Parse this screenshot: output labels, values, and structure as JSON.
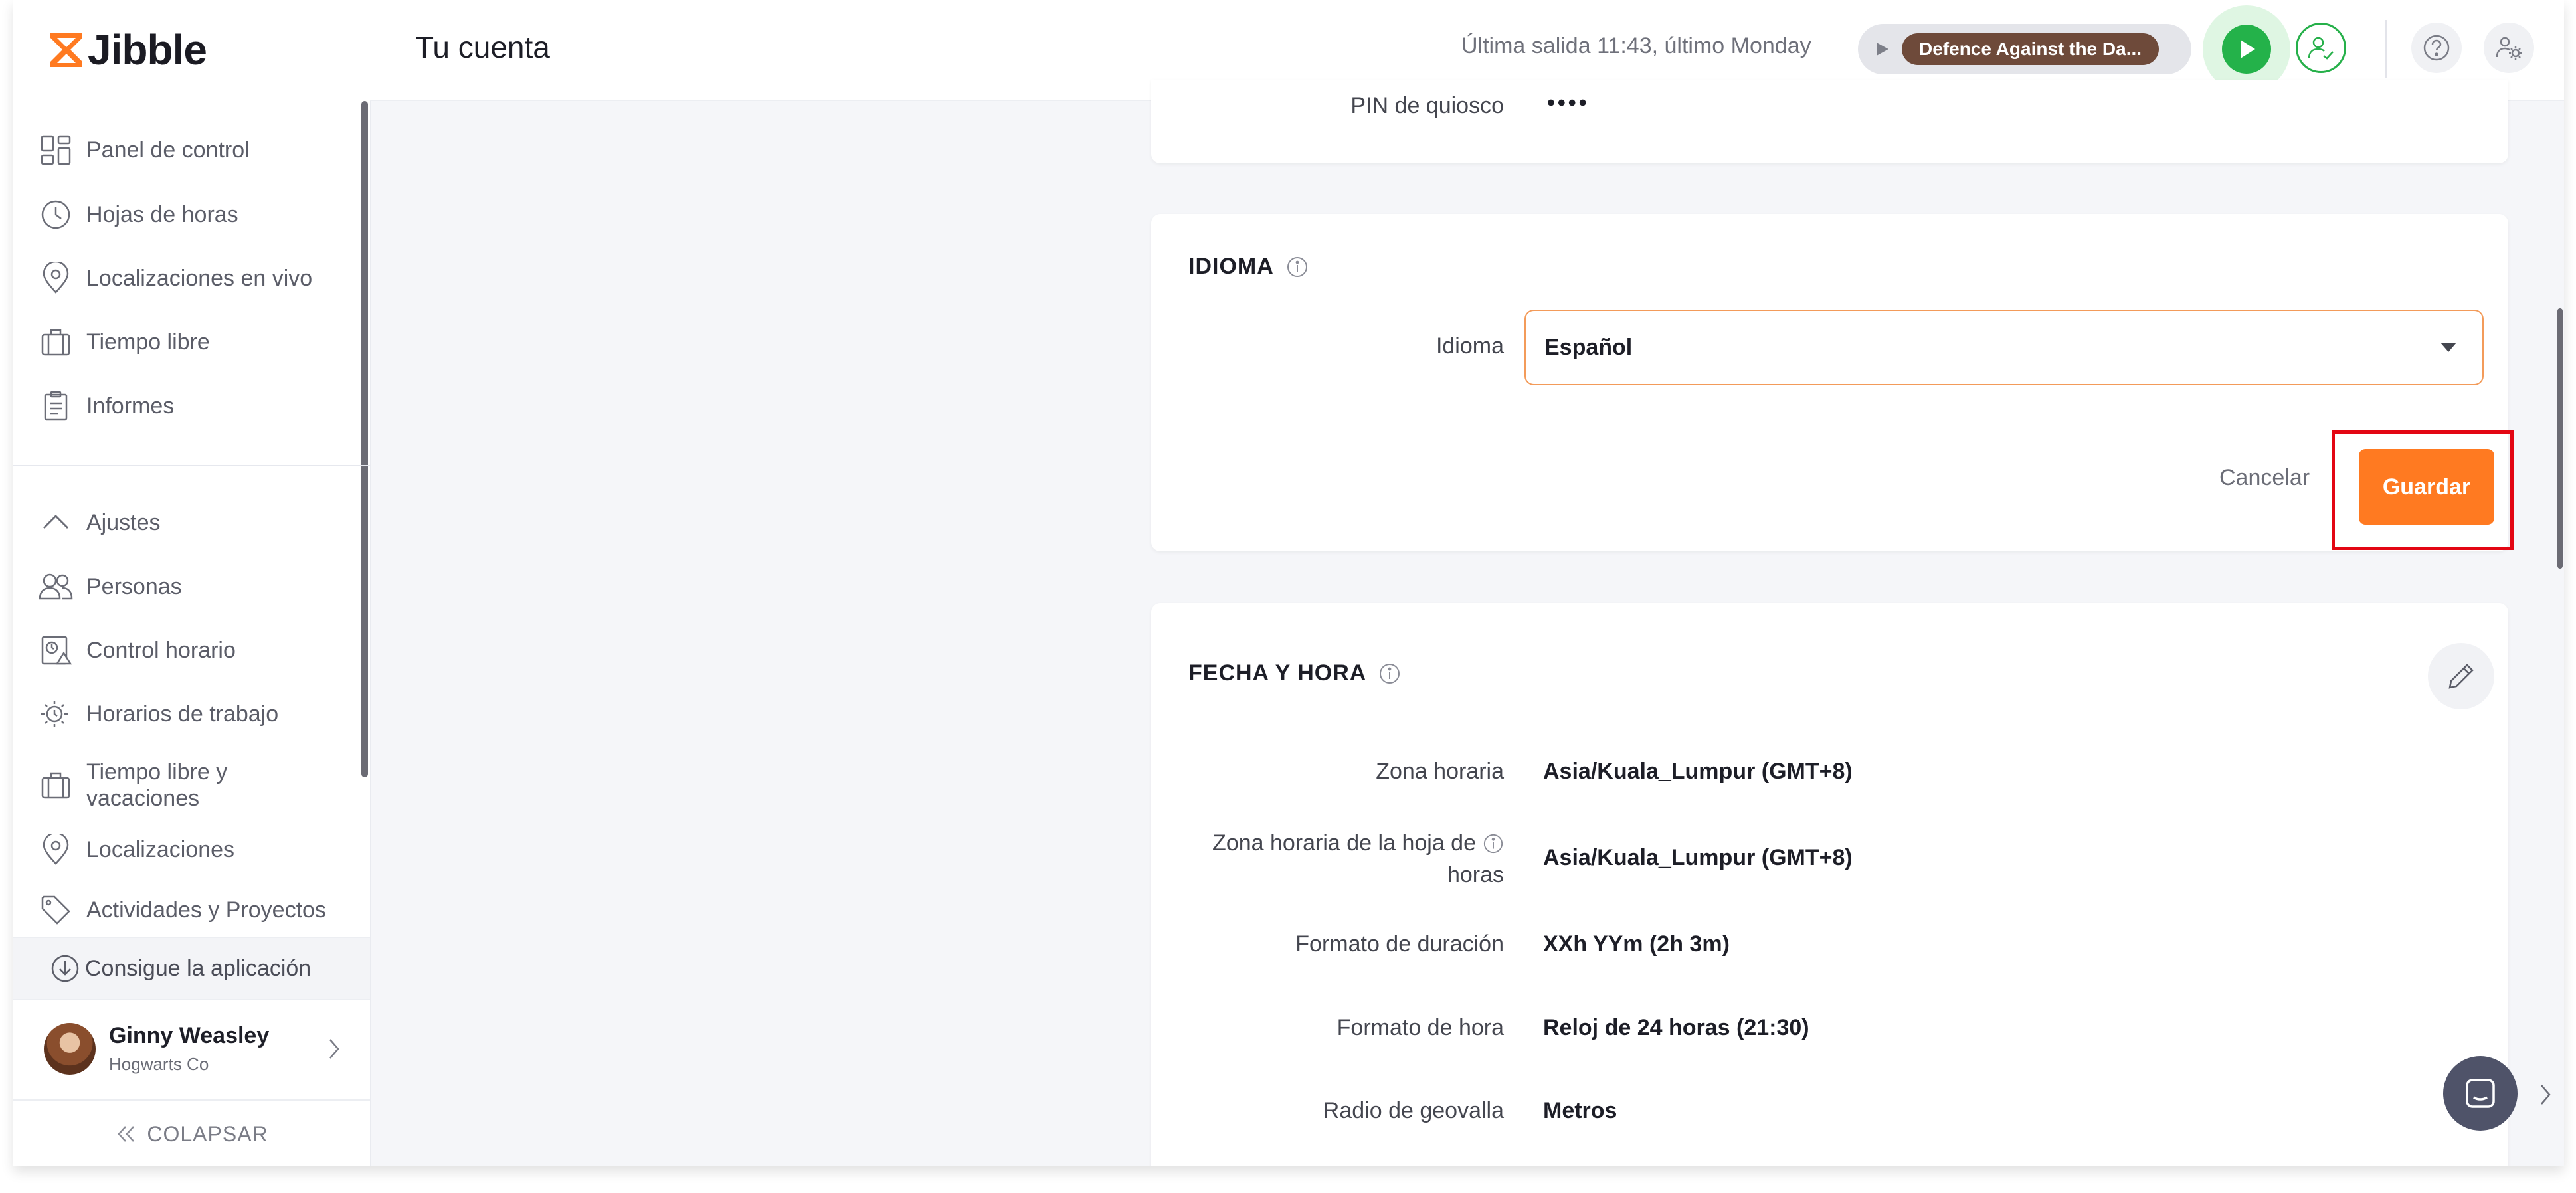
{
  "app": {
    "name": "Jibble"
  },
  "sidebar": {
    "items": [
      {
        "label": "Panel de control",
        "icon": "dashboard-icon"
      },
      {
        "label": "Hojas de horas",
        "icon": "clock-icon"
      },
      {
        "label": "Localizaciones en vivo",
        "icon": "location-pin-icon"
      },
      {
        "label": "Tiempo libre",
        "icon": "suitcase-icon"
      },
      {
        "label": "Informes",
        "icon": "report-icon"
      }
    ],
    "settings": {
      "label": "Ajustes",
      "items": [
        {
          "label": "Personas",
          "icon": "people-icon"
        },
        {
          "label": "Control horario",
          "icon": "time-tracking-icon"
        },
        {
          "label": "Horarios de trabajo",
          "icon": "work-schedule-icon"
        },
        {
          "label": "Tiempo libre y vacaciones",
          "icon": "suitcase-icon"
        },
        {
          "label": "Localizaciones",
          "icon": "location-pin-icon"
        },
        {
          "label": "Actividades y Proyectos",
          "icon": "tag-icon"
        }
      ]
    },
    "get_app": "Consigue la aplicación",
    "user": {
      "name": "Ginny Weasley",
      "org": "Hogwarts Co"
    },
    "collapse": "COLAPSAR"
  },
  "header": {
    "title": "Tu cuenta",
    "last_out": "Última salida 11:43, último Monday",
    "activity": "Defence Against the Da..."
  },
  "account": {
    "kiosk_pin": {
      "label": "PIN de quiosco",
      "value": "••••"
    },
    "language": {
      "title": "IDIOMA",
      "label": "Idioma",
      "value": "Español",
      "cancel": "Cancelar",
      "save": "Guardar"
    },
    "datetime": {
      "title": "FECHA Y HORA",
      "fields": [
        {
          "label": "Zona horaria",
          "value": "Asia/Kuala_Lumpur (GMT+8)"
        },
        {
          "label1": "Zona horaria de la hoja de",
          "label2": "horas",
          "value": "Asia/Kuala_Lumpur (GMT+8)"
        },
        {
          "label": "Formato de duración",
          "value": "XXh YYm (2h 3m)"
        },
        {
          "label": "Formato de hora",
          "value": "Reloj de 24 horas (21:30)"
        },
        {
          "label": "Radio de geovalla",
          "value": "Metros"
        }
      ]
    }
  },
  "colors": {
    "brand": "#ff7a21",
    "clock_in": "#24b24a",
    "highlight": "#e30613",
    "activity_tag": "#6e4a3a"
  }
}
